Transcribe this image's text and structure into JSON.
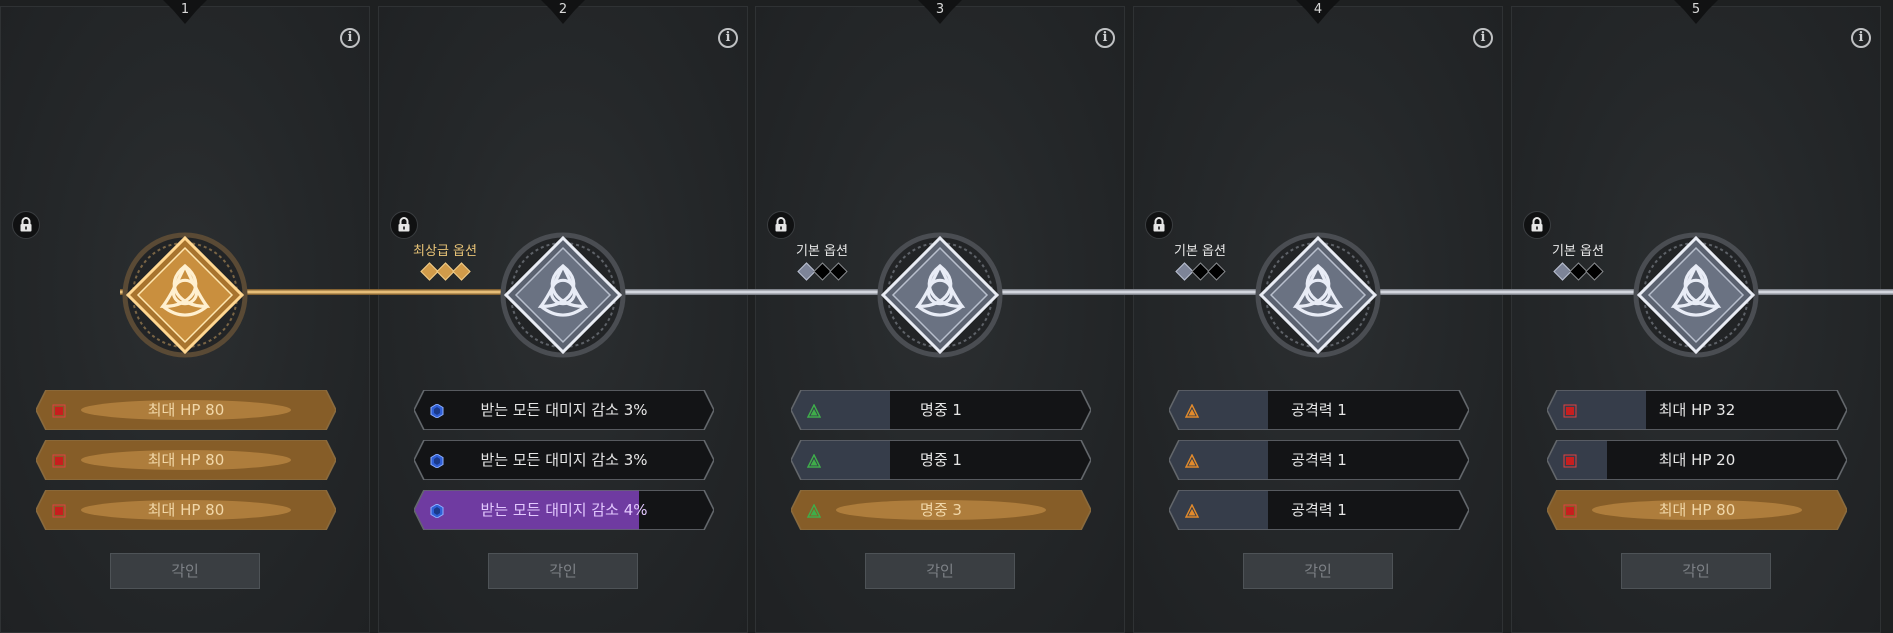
{
  "panels": [
    {
      "number": "1",
      "state": "active-gold",
      "grade_label": "",
      "grade_pips": [],
      "options": [
        {
          "text": "최대 HP 80",
          "icon": "red-square-icon",
          "fill": 1.0,
          "style": "gold"
        },
        {
          "text": "최대 HP 80",
          "icon": "red-square-icon",
          "fill": 1.0,
          "style": "gold"
        },
        {
          "text": "최대 HP 80",
          "icon": "red-square-icon",
          "fill": 1.0,
          "style": "gold"
        }
      ],
      "button_label": "각인"
    },
    {
      "number": "2",
      "state": "silver",
      "grade_label": "최상급 옵션",
      "grade_pips": [
        "gold",
        "gold",
        "gold"
      ],
      "options": [
        {
          "text": "받는 모든 대미지 감소 3%",
          "icon": "blue-hexagon-icon",
          "fill": 0.0,
          "style": "dark"
        },
        {
          "text": "받는 모든 대미지 감소 3%",
          "icon": "blue-hexagon-icon",
          "fill": 0.0,
          "style": "dark"
        },
        {
          "text": "받는 모든 대미지 감소 4%",
          "icon": "blue-hexagon-icon",
          "fill": 0.75,
          "style": "purple"
        }
      ],
      "button_label": "각인"
    },
    {
      "number": "3",
      "state": "silver",
      "grade_label": "기본 옵션",
      "grade_pips": [
        "on",
        "off",
        "off"
      ],
      "options": [
        {
          "text": "명중 1",
          "icon": "green-triangle-icon",
          "fill": 0.33,
          "style": "slate"
        },
        {
          "text": "명중 1",
          "icon": "green-triangle-icon",
          "fill": 0.33,
          "style": "slate"
        },
        {
          "text": "명중 3",
          "icon": "green-triangle-icon",
          "fill": 1.0,
          "style": "gold"
        }
      ],
      "button_label": "각인"
    },
    {
      "number": "4",
      "state": "silver",
      "grade_label": "기본 옵션",
      "grade_pips": [
        "on",
        "off",
        "off"
      ],
      "options": [
        {
          "text": "공격력 1",
          "icon": "orange-triangle-icon",
          "fill": 0.33,
          "style": "slate"
        },
        {
          "text": "공격력 1",
          "icon": "orange-triangle-icon",
          "fill": 0.33,
          "style": "slate"
        },
        {
          "text": "공격력 1",
          "icon": "orange-triangle-icon",
          "fill": 0.33,
          "style": "slate"
        }
      ],
      "button_label": "각인"
    },
    {
      "number": "5",
      "state": "silver",
      "grade_label": "기본 옵션",
      "grade_pips": [
        "on",
        "off",
        "off"
      ],
      "options": [
        {
          "text": "최대 HP 32",
          "icon": "red-square-icon",
          "fill": 0.33,
          "style": "slate"
        },
        {
          "text": "최대 HP 20",
          "icon": "red-square-icon",
          "fill": 0.2,
          "style": "slate"
        },
        {
          "text": "최대 HP 80",
          "icon": "red-square-icon",
          "fill": 1.0,
          "style": "gold"
        }
      ],
      "button_label": "각인"
    }
  ],
  "colors": {
    "gold": "#d19b4a",
    "silver": "#c9cdd8",
    "purple": "#7a3fb0",
    "slate": "#3b4150",
    "red_icon": "#c81e1e",
    "blue_icon": "#2f5fd6",
    "green_icon": "#3fae4a",
    "orange_icon": "#e28a2b"
  }
}
